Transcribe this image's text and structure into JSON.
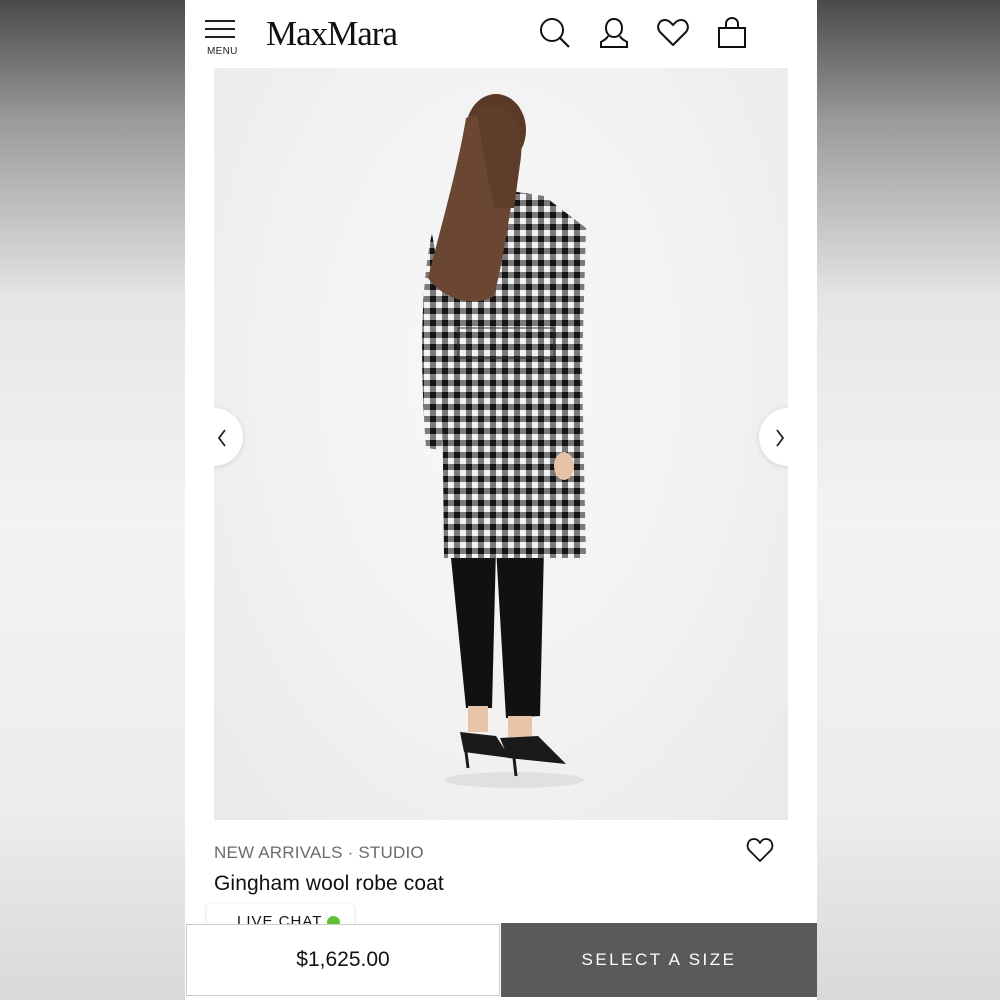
{
  "header": {
    "menu_label": "MENU",
    "logo": "MaxMara",
    "icons": [
      "search-icon",
      "account-icon",
      "wishlist-icon",
      "bag-icon"
    ]
  },
  "gallery": {
    "image_subject": "model-back-view-gingham-coat",
    "nav": [
      "chevron-left-icon",
      "chevron-right-icon"
    ]
  },
  "product": {
    "category": "NEW ARRIVALS · STUDIO",
    "title": "Gingham wool robe coat",
    "wishlist_icon": "heart-icon"
  },
  "chat": {
    "label": "LIVE CHAT",
    "status_color": "#5ec232"
  },
  "purchase": {
    "price": "$1,625.00",
    "cta_label": "SELECT A SIZE",
    "cta_color": "#5a5a5a"
  }
}
